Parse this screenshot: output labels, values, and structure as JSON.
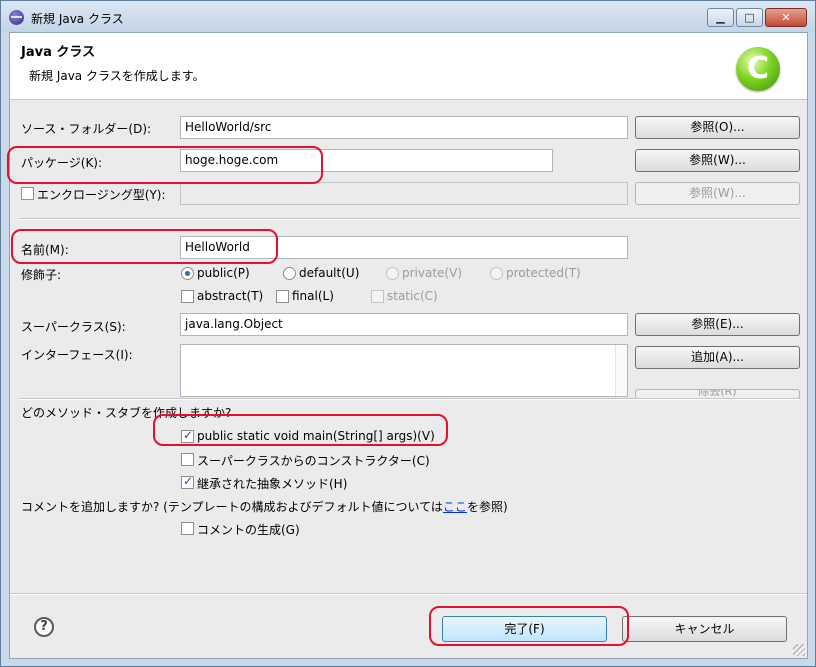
{
  "window": {
    "title": "新規 Java クラス",
    "controls": {
      "minimize": "▁",
      "maximize": "□",
      "close": "✕"
    }
  },
  "banner": {
    "title": "Java クラス",
    "description": "新規 Java クラスを作成します。",
    "logo_letter": "C"
  },
  "source_folder": {
    "label": "ソース・フォルダー(D):",
    "value": "HelloWorld/src",
    "browse": "参照(O)..."
  },
  "package": {
    "label": "パッケージ(K):",
    "value": "hoge.hoge.com",
    "browse": "参照(W)..."
  },
  "enclosing_type": {
    "label": "エンクロージング型(Y):",
    "value": "",
    "browse": "参照(W)..."
  },
  "name": {
    "label": "名前(M):",
    "value": "HelloWorld"
  },
  "modifiers": {
    "label": "修飾子:",
    "public": "public(P)",
    "default": "default(U)",
    "private": "private(V)",
    "protected": "protected(T)",
    "abstract": "abstract(T)",
    "final": "final(L)",
    "static": "static(C)"
  },
  "superclass": {
    "label": "スーパークラス(S):",
    "value": "java.lang.Object",
    "browse": "参照(E)..."
  },
  "interfaces": {
    "label": "インターフェース(I):",
    "add": "追加(A)...",
    "remove": "除去(R)"
  },
  "stubs": {
    "question": "どのメソッド・スタブを作成しますか?",
    "main": "public static void main(String[] args)(V)",
    "constructors": "スーパークラスからのコンストラクター(C)",
    "inherited": "継承された抽象メソッド(H)"
  },
  "comments": {
    "question_prefix": "コメントを追加しますか? (テンプレートの構成およびデフォルト値については",
    "link": "ここ",
    "question_suffix": "を参照)",
    "generate": "コメントの生成(G)"
  },
  "footer": {
    "help": "?",
    "finish": "完了(F)",
    "cancel": "キャンセル"
  },
  "colors": {
    "highlight_ring": "#e3102f",
    "link": "#0033cc",
    "accent": "#3c7fb1"
  }
}
